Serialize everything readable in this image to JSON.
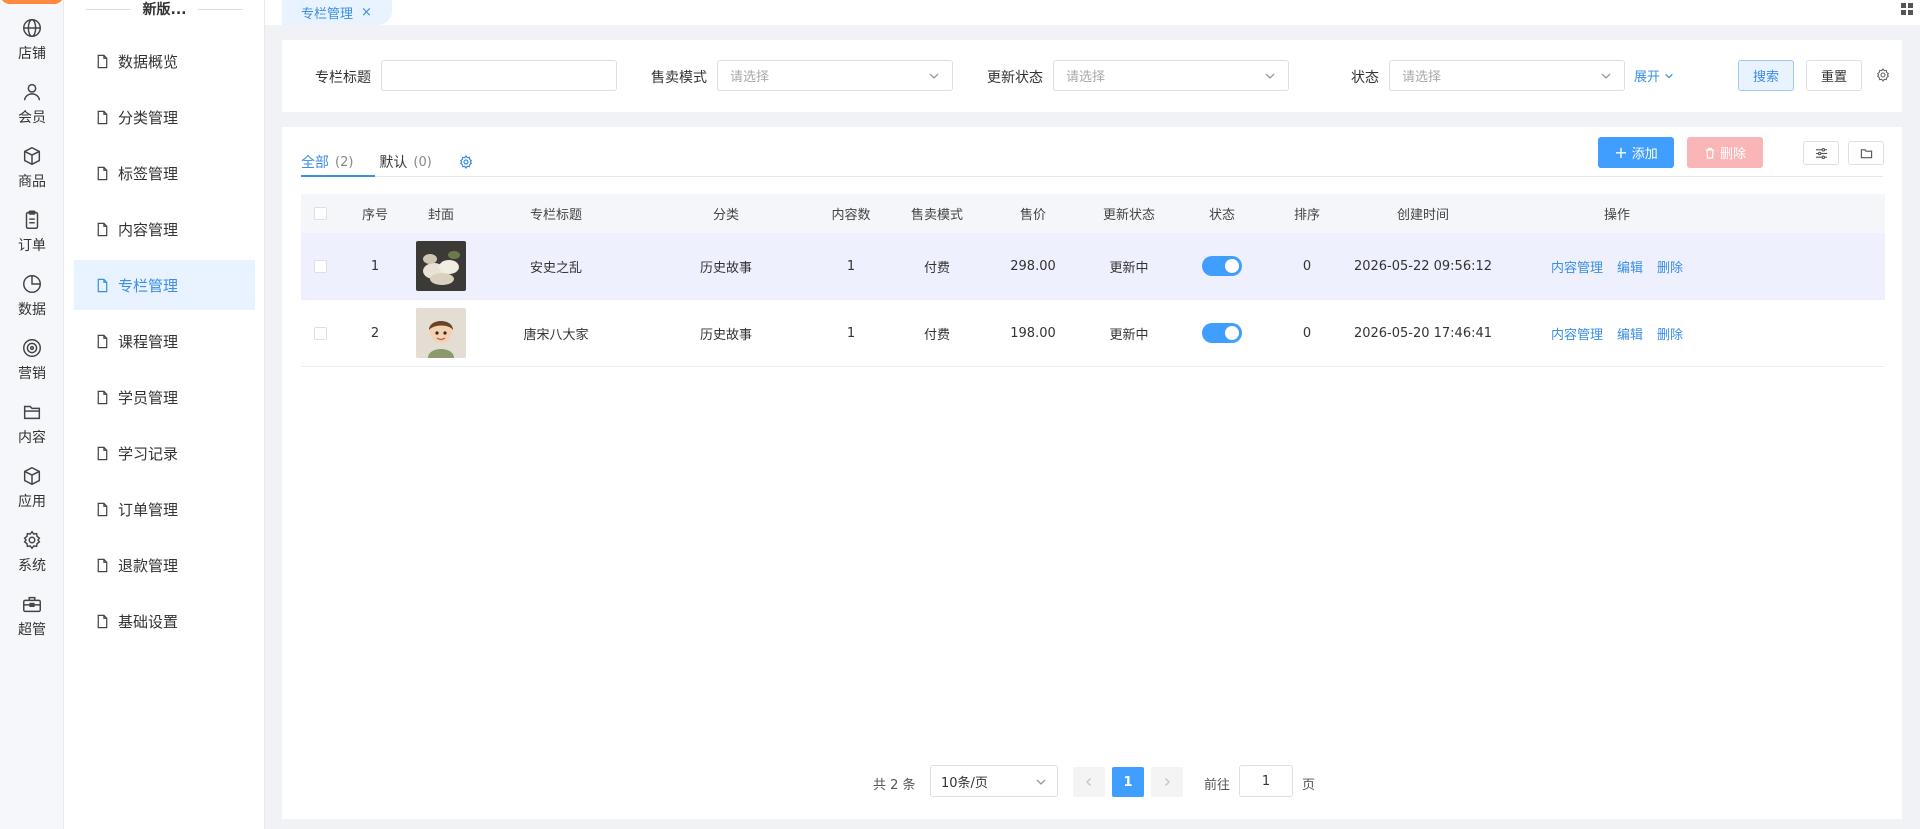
{
  "rail": {
    "items": [
      {
        "label": "店铺",
        "icon": "globe-icon"
      },
      {
        "label": "会员",
        "icon": "user-icon"
      },
      {
        "label": "商品",
        "icon": "cube-icon"
      },
      {
        "label": "订单",
        "icon": "clipboard-icon"
      },
      {
        "label": "数据",
        "icon": "pie-chart-icon"
      },
      {
        "label": "营销",
        "icon": "target-icon"
      },
      {
        "label": "内容",
        "icon": "folder-icon"
      },
      {
        "label": "应用",
        "icon": "box-icon"
      },
      {
        "label": "系统",
        "icon": "gear-icon"
      },
      {
        "label": "超管",
        "icon": "toolbox-icon"
      }
    ]
  },
  "submenu": {
    "title": "新版...",
    "items": [
      "数据概览",
      "分类管理",
      "标签管理",
      "内容管理",
      "专栏管理",
      "课程管理",
      "学员管理",
      "学习记录",
      "订单管理",
      "退款管理",
      "基础设置"
    ],
    "active_index": 4
  },
  "tabbar": {
    "tab_label": "专栏管理",
    "close": "×"
  },
  "filter": {
    "title_label": "专栏标题",
    "title_value": "",
    "sale_label": "售卖模式",
    "sale_placeholder": "请选择",
    "update_label": "更新状态",
    "update_placeholder": "请选择",
    "status_label": "状态",
    "status_placeholder": "请选择",
    "expand": "展开",
    "search": "搜索",
    "reset": "重置"
  },
  "tabs": {
    "all_label": "全部",
    "all_count": "(2)",
    "default_label": "默认",
    "default_count": "(0)"
  },
  "toolbar": {
    "add": "添加",
    "delete": "删除"
  },
  "table": {
    "headers": [
      "序号",
      "封面",
      "专栏标题",
      "分类",
      "内容数",
      "售卖模式",
      "售价",
      "更新状态",
      "状态",
      "排序",
      "创建时间",
      "操作"
    ],
    "rows": [
      {
        "index": "1",
        "title": "安史之乱",
        "category": "历史故事",
        "count": "1",
        "mode": "付费",
        "price": "298.00",
        "update": "更新中",
        "status_on": true,
        "sort": "0",
        "created": "2026-05-22 09:56:12"
      },
      {
        "index": "2",
        "title": "唐宋八大家",
        "category": "历史故事",
        "count": "1",
        "mode": "付费",
        "price": "198.00",
        "update": "更新中",
        "status_on": true,
        "sort": "0",
        "created": "2026-05-20 17:46:41"
      }
    ],
    "actions": [
      "内容管理",
      "编辑",
      "删除"
    ]
  },
  "pagination": {
    "total": "共 2 条",
    "page_size": "10条/页",
    "current": "1",
    "goto_label": "前往",
    "goto_value": "1",
    "page_label": "页"
  },
  "colors": {
    "accent": "#409eff",
    "danger_light": "#fab6b6",
    "active_bg": "#e8f3ff"
  }
}
